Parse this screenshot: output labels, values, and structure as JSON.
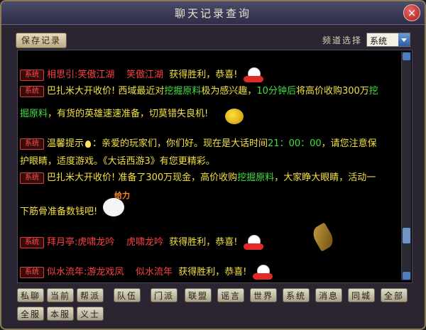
{
  "window": {
    "title": "聊天记录查询",
    "close_label": "×"
  },
  "toolbar": {
    "save_label": "保存记录",
    "channel_label": "频道选择",
    "channel_value": "系统"
  },
  "system_tag": "系统",
  "messages": [
    {
      "parts": [
        "相思引",
        ":",
        "笑傲江湖",
        "笑傲江湖",
        "获得胜利，恭喜!"
      ]
    },
    {
      "line1": [
        "巴扎米",
        "大开收价! 西域最近对",
        "挖掘原料",
        "极为感兴趣，",
        "10分钟后",
        "将高价收购300万",
        "挖"
      ],
      "line2": [
        "掘原料",
        "，有货的英雄速速准备，切莫错失良机!"
      ]
    },
    {
      "line1": [
        "温馨提示",
        "：亲爱的玩家们，你们好。现在是大话时间",
        "21：00：00",
        "，请您注意保"
      ],
      "line2": [
        "护眼睛，适度游戏。《大话西游3》有您更精彩。"
      ]
    },
    {
      "line1": [
        "巴扎米",
        "大开收价! 准备了300万现金，高价收购",
        "挖掘原料",
        "，大家睁大眼睛，活动一"
      ],
      "line2": [
        "下筋骨准备数钱吧!"
      ]
    },
    {
      "parts": [
        "拜月亭",
        ":",
        "虎啸龙吟",
        "虎啸龙吟",
        "获得胜利，恭喜!"
      ]
    },
    {
      "parts": [
        "似水流年",
        ":",
        "游龙戏凤",
        "似水流年",
        "获得胜利，恭喜!"
      ]
    }
  ],
  "sticker_text": "给力",
  "tabs": [
    "私聊",
    "当前",
    "帮派",
    "队伍",
    "门派",
    "联盟",
    "谣言",
    "世界",
    "系统",
    "消息",
    "同城",
    "全部",
    "全服",
    "本服",
    "义士"
  ]
}
